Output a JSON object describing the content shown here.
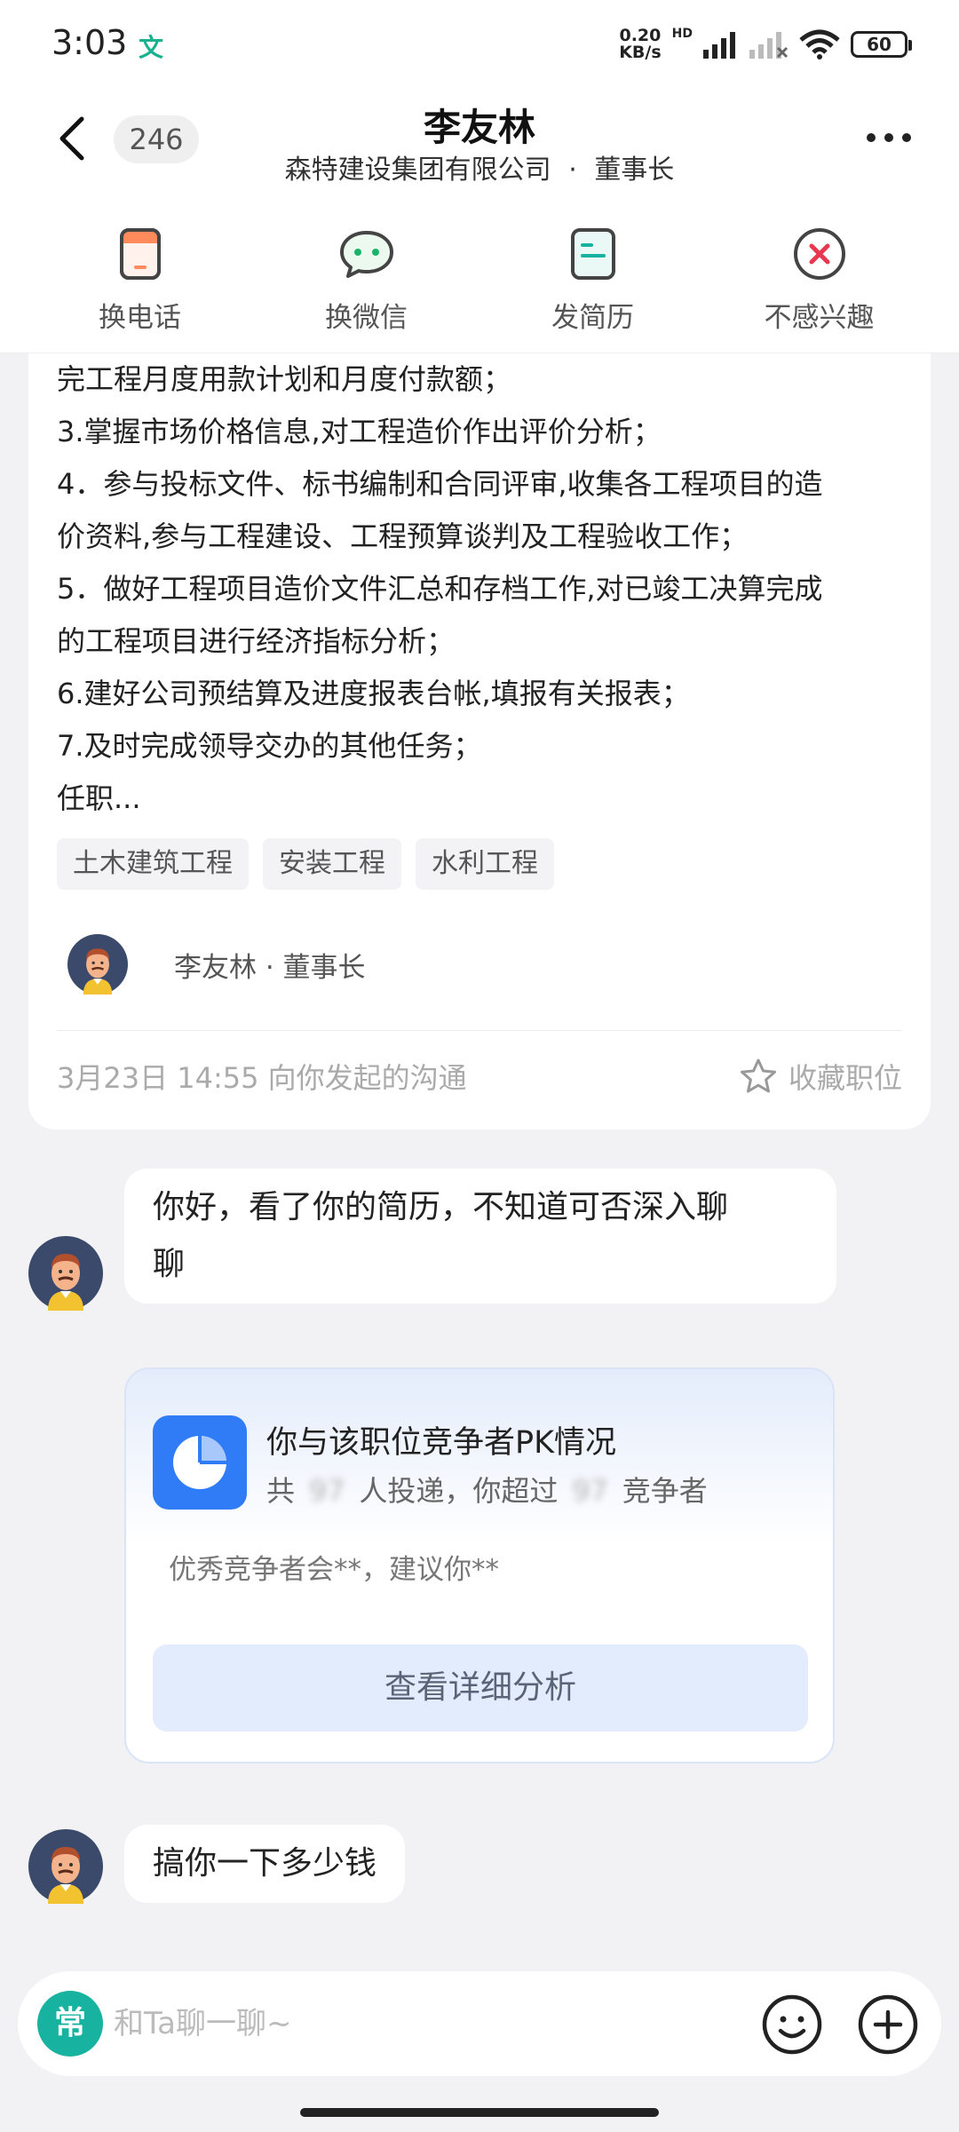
{
  "status_bar": {
    "time": "3:03",
    "lang_icon_text": "文",
    "net_speed_value": "0.20",
    "net_speed_unit": "KB/s",
    "hd_label": "HD",
    "battery": "60"
  },
  "header": {
    "unread_count": "246",
    "contact_name": "李友林",
    "company": "森特建设集团有限公司",
    "separator": "·",
    "position": "董事长"
  },
  "actions": [
    {
      "label": "换电话",
      "icon": "phone-icon"
    },
    {
      "label": "换微信",
      "icon": "wechat-icon"
    },
    {
      "label": "发简历",
      "icon": "resume-icon"
    },
    {
      "label": "不感兴趣",
      "icon": "not-interested-icon"
    }
  ],
  "job_card": {
    "description_lines": [
      "完工程月度用款计划和月度付款额；",
      "3.掌握市场价格信息,对工程造价作出评价分析；",
      "4．参与投标文件、标书编制和合同评审,收集各工程项目的造",
      "价资料,参与工程建设、工程预算谈判及工程验收工作；",
      "5．做好工程项目造价文件汇总和存档工作,对已竣工决算完成",
      "的工程项目进行经济指标分析；",
      "6.建好公司预结算及进度报表台帐,填报有关报表；",
      "7.及时完成领导交办的其他任务；",
      "任职..."
    ],
    "tags": [
      "土木建筑工程",
      "安装工程",
      "水利工程"
    ],
    "recruiter": "李友林 · 董事长",
    "timestamp": "3月23日 14:55 向你发起的沟通",
    "favorite_label": "收藏职位"
  },
  "messages": [
    {
      "lines": [
        "你好，看了你的简历，不知道可否深入聊",
        "聊"
      ]
    },
    {
      "lines": [
        "搞你一下多少钱"
      ]
    }
  ],
  "pk_card": {
    "title": "你与该职位竞争者PK情况",
    "line_prefix": "共",
    "blurred_count": "97",
    "line_mid": "人投递，你超过",
    "blurred_exceed": "97",
    "line_suffix": "竞争者",
    "hint": "优秀竞争者会**，建议你**",
    "button": "查看详细分析",
    "accent": "#2f7cf6"
  },
  "input": {
    "quick_reply_label": "常",
    "placeholder": "和Ta聊一聊~"
  },
  "colors": {
    "accent_green": "#18b3a0",
    "reject_red": "#e8384f",
    "background": "#f2f2f4"
  }
}
